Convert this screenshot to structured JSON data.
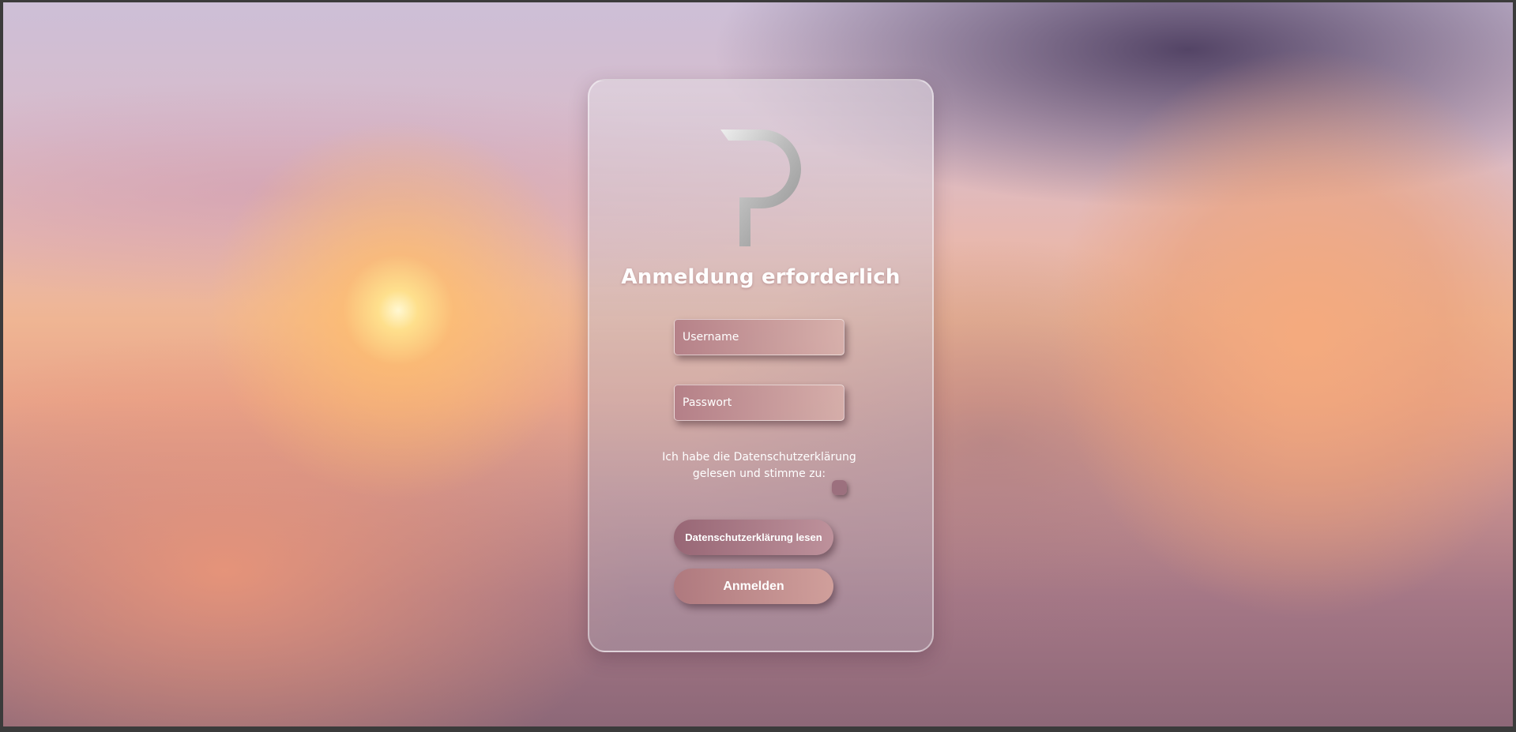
{
  "login": {
    "title": "Anmeldung erforderlich",
    "username_placeholder": "Username",
    "password_placeholder": "Passwort",
    "consent_line1": "Ich habe die Datenschutzerklärung",
    "consent_line2": "gelesen und stimme zu:",
    "privacy_button_label": "Datenschutzerklärung lesen",
    "login_button_label": "Anmelden"
  },
  "icons": {
    "logo": "p-logo-icon"
  },
  "colors": {
    "text": "#ffffff",
    "logo_metal": "#b8b8b8"
  }
}
